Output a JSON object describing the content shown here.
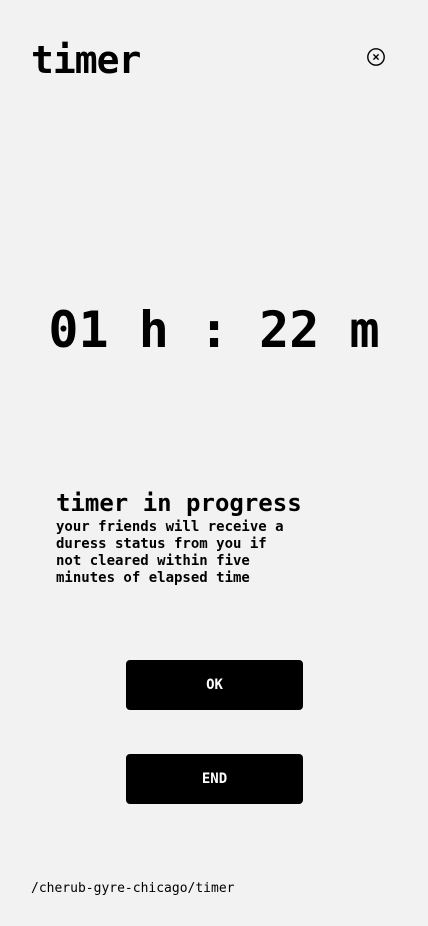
{
  "header": {
    "title": "timer",
    "close_icon": "close-circle-icon"
  },
  "timer": {
    "hours": "01",
    "hours_unit": "h",
    "separator": ":",
    "minutes": "22",
    "minutes_unit": "m"
  },
  "status": {
    "heading": "timer in progress",
    "description": "your friends will receive a duress status from you if not cleared within five minutes of elapsed time"
  },
  "actions": {
    "ok_label": "OK",
    "end_label": "END"
  },
  "footer": {
    "path": "/cherub-gyre-chicago/timer"
  },
  "colors": {
    "background": "#f2f2f2",
    "button": "#000000",
    "button_text": "#ffffff"
  }
}
